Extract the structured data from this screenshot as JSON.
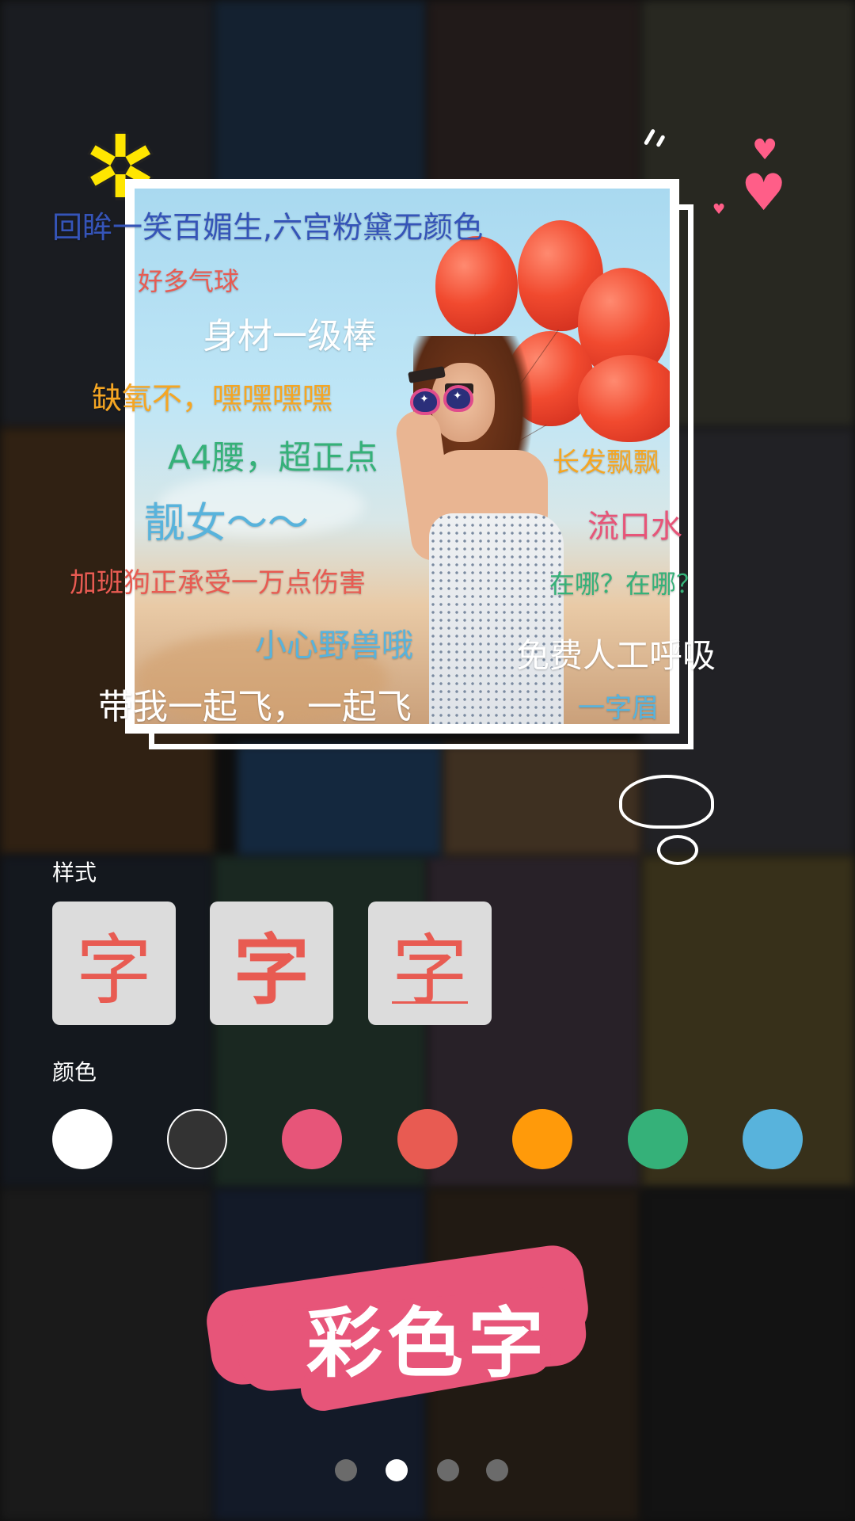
{
  "captions": [
    {
      "text": "回眸一笑百媚生,六宫粉黛无颜色",
      "color": "#3554b8"
    },
    {
      "text": "好多气球",
      "color": "#e85b52"
    },
    {
      "text": "身材一级棒",
      "color": "#ffffff"
    },
    {
      "text": "缺氧不，嘿嘿嘿嘿",
      "color": "#f5a623"
    },
    {
      "text": "A4腰，超正点",
      "color": "#35b179"
    },
    {
      "text": "长发飘飘",
      "color": "#f5a623"
    },
    {
      "text": "靓女～～",
      "color": "#58b3dc"
    },
    {
      "text": "流口水",
      "color": "#e75579"
    },
    {
      "text": "加班狗正承受一万点伤害",
      "color": "#e85b52"
    },
    {
      "text": "在哪？在哪？",
      "color": "#35b179"
    },
    {
      "text": "小心野兽哦",
      "color": "#58b3dc"
    },
    {
      "text": "免费人工呼吸",
      "color": "#ffffff"
    },
    {
      "text": "带我一起飞，一起飞",
      "color": "#ffffff"
    },
    {
      "text": "一字眉",
      "color": "#58b3dc"
    }
  ],
  "style": {
    "label": "样式",
    "options": [
      {
        "glyph": "字",
        "variant": "regular"
      },
      {
        "glyph": "字",
        "variant": "bold"
      },
      {
        "glyph": "字",
        "variant": "underline"
      }
    ]
  },
  "color": {
    "label": "颜色",
    "swatches": [
      "#ffffff",
      "#333333",
      "#e75579",
      "#e85b52",
      "#ff9a0a",
      "#35b179",
      "#58b3dc"
    ]
  },
  "promo": {
    "text": "彩色字",
    "color": "#e75579"
  },
  "pager": {
    "count": 4,
    "active": 1
  }
}
